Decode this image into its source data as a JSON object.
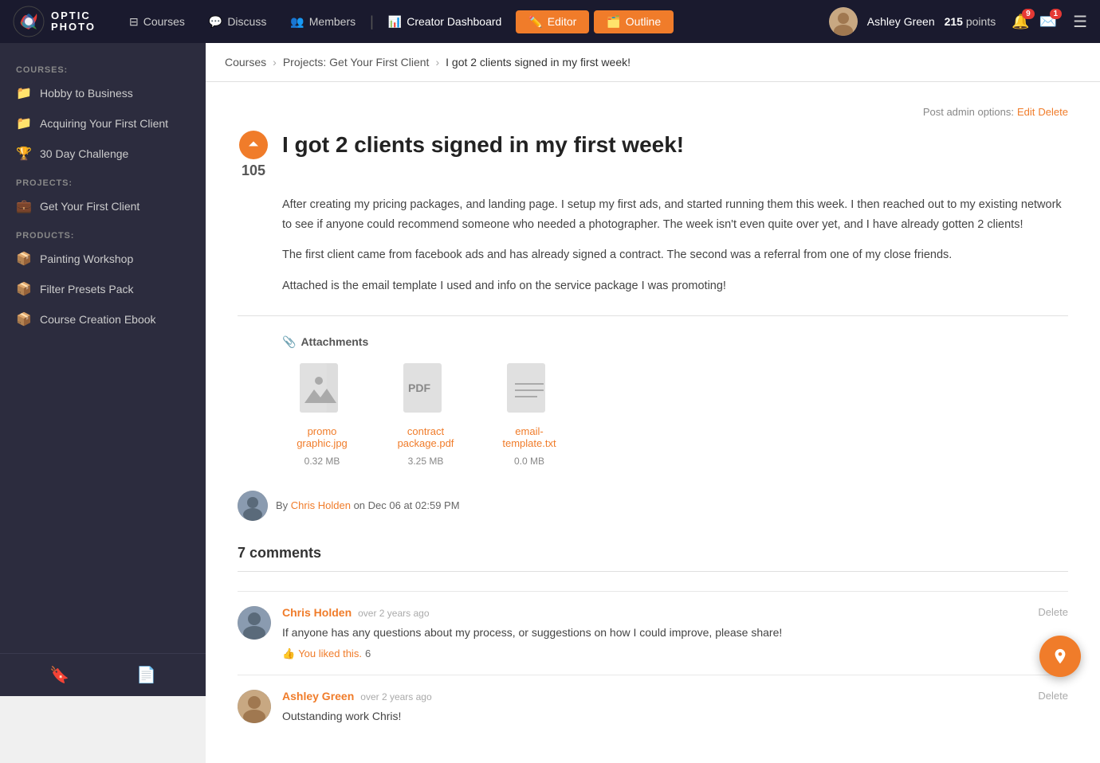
{
  "app": {
    "logo_text_line1": "OPTIC",
    "logo_text_line2": "PHOTO"
  },
  "header": {
    "nav": [
      {
        "id": "courses",
        "label": "Courses",
        "icon": "courses-icon"
      },
      {
        "id": "discuss",
        "label": "Discuss",
        "icon": "discuss-icon"
      },
      {
        "id": "members",
        "label": "Members",
        "icon": "members-icon"
      },
      {
        "id": "creator-dashboard",
        "label": "Creator Dashboard",
        "icon": "dashboard-icon"
      }
    ],
    "btn_editor": "Editor",
    "btn_outline": "Outline",
    "user_name": "Ashley Green",
    "user_points_label": "215",
    "user_points_suffix": "points",
    "notif_count_1": "9",
    "notif_count_2": "1"
  },
  "sidebar": {
    "sections": [
      {
        "label": "COURSES:",
        "items": [
          {
            "id": "hobby-to-business",
            "label": "Hobby to Business",
            "icon": "folder"
          },
          {
            "id": "acquiring-first-client",
            "label": "Acquiring Your First Client",
            "icon": "folder"
          },
          {
            "id": "30-day-challenge",
            "label": "30 Day Challenge",
            "icon": "trophy"
          }
        ]
      },
      {
        "label": "PROJECTS:",
        "items": [
          {
            "id": "get-first-client",
            "label": "Get Your First Client",
            "icon": "briefcase"
          }
        ]
      },
      {
        "label": "PRODUCTS:",
        "items": [
          {
            "id": "painting-workshop",
            "label": "Painting Workshop",
            "icon": "product"
          },
          {
            "id": "filter-presets-pack",
            "label": "Filter Presets Pack",
            "icon": "product"
          },
          {
            "id": "course-creation-ebook",
            "label": "Course Creation Ebook",
            "icon": "product"
          }
        ]
      }
    ],
    "bottom_icons": [
      "bookmark-icon",
      "document-icon"
    ]
  },
  "breadcrumb": {
    "items": [
      "Courses",
      "Projects: Get Your First Client",
      "I got 2 clients signed in my first week!"
    ]
  },
  "post": {
    "admin_label": "Post admin options:",
    "admin_edit": "Edit",
    "admin_delete": "Delete",
    "vote_count": "105",
    "title": "I got 2 clients signed in my first week!",
    "body_p1": "After creating my pricing packages, and landing page. I setup my first ads, and started running them this week. I then reached out to my existing network to see if anyone could recommend someone who needed a photographer. The week isn't even quite over yet, and I have already gotten 2 clients!",
    "body_p2": "The first client came from facebook ads and has already signed a contract. The second was a referral from one of my close friends.",
    "body_p3": "Attached is the email template I used and info on the service package I was promoting!",
    "attachments_label": "Attachments",
    "attachments": [
      {
        "name": "promo graphic.jpg",
        "size": "0.32 MB",
        "type": "image"
      },
      {
        "name": "contract package.pdf",
        "size": "3.25 MB",
        "type": "pdf"
      },
      {
        "name": "email-template.txt",
        "size": "0.0 MB",
        "type": "text"
      }
    ],
    "author": "Chris Holden",
    "author_prefix": "By",
    "date": "on Dec 06 at 02:59 PM"
  },
  "comments": {
    "count_label": "7 comments",
    "items": [
      {
        "author": "Chris Holden",
        "time": "over 2 years ago",
        "text": "If anyone has any questions about my process, or suggestions on how I could improve, please share!",
        "liked": true,
        "liked_label": "You liked this.",
        "like_count": "6",
        "can_delete": true
      },
      {
        "author": "Ashley Green",
        "time": "over 2 years ago",
        "text": "Outstanding work Chris!",
        "liked": false,
        "liked_label": "",
        "like_count": "",
        "can_delete": true
      }
    ]
  }
}
